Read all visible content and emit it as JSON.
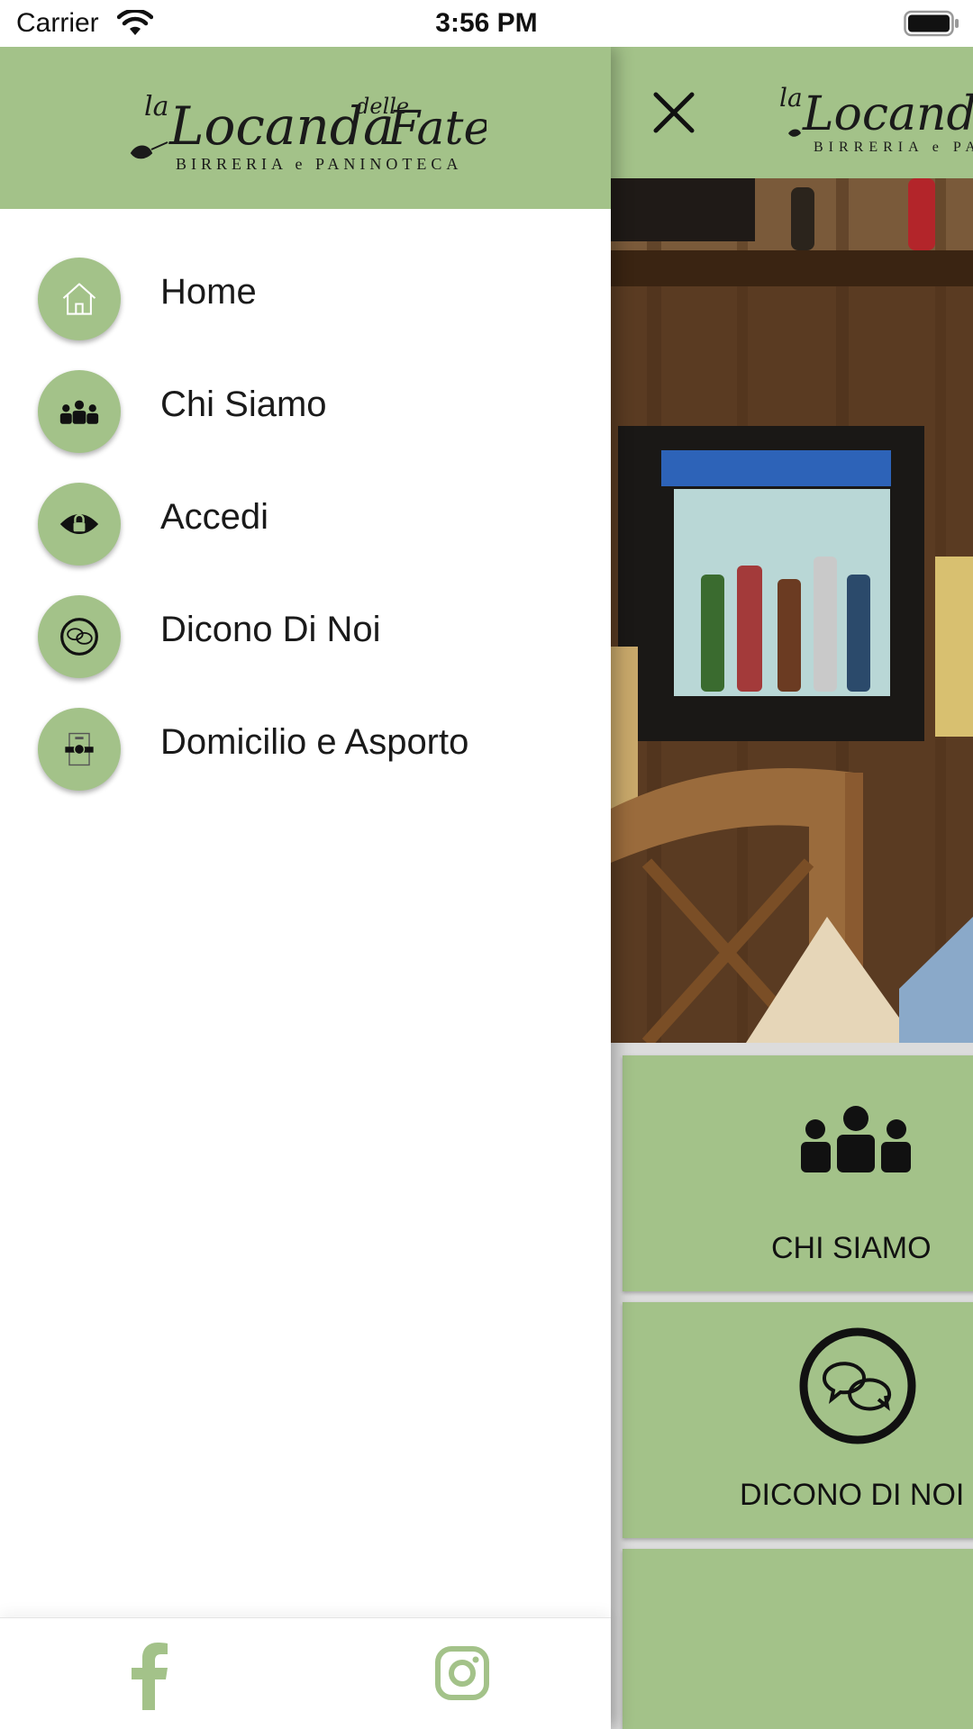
{
  "status_bar": {
    "carrier": "Carrier",
    "time": "3:56 PM"
  },
  "brand": {
    "logo_script_a": "la",
    "logo_script_b": "Locanda",
    "logo_script_c": "delle",
    "logo_script_d": "Fate",
    "logo_tagline": "BIRRERIA e PANINOTECA",
    "accent_color": "#a3c289"
  },
  "drawer": {
    "menu": [
      {
        "label": "Home",
        "icon": "home-icon"
      },
      {
        "label": "Chi Siamo",
        "icon": "people-icon"
      },
      {
        "label": "Accedi",
        "icon": "lock-icon"
      },
      {
        "label": "Dicono Di Noi",
        "icon": "chat-icon"
      },
      {
        "label": "Domicilio e Asporto",
        "icon": "delivery-icon"
      }
    ],
    "footer": {
      "facebook_icon": "facebook-icon",
      "instagram_icon": "instagram-icon"
    }
  },
  "main": {
    "tiles": [
      {
        "label": "CHI SIAMO",
        "icon": "people-icon"
      },
      {
        "label": "DICONO DI NOI",
        "icon": "chat-icon"
      },
      {
        "label": "",
        "icon": ""
      }
    ]
  }
}
